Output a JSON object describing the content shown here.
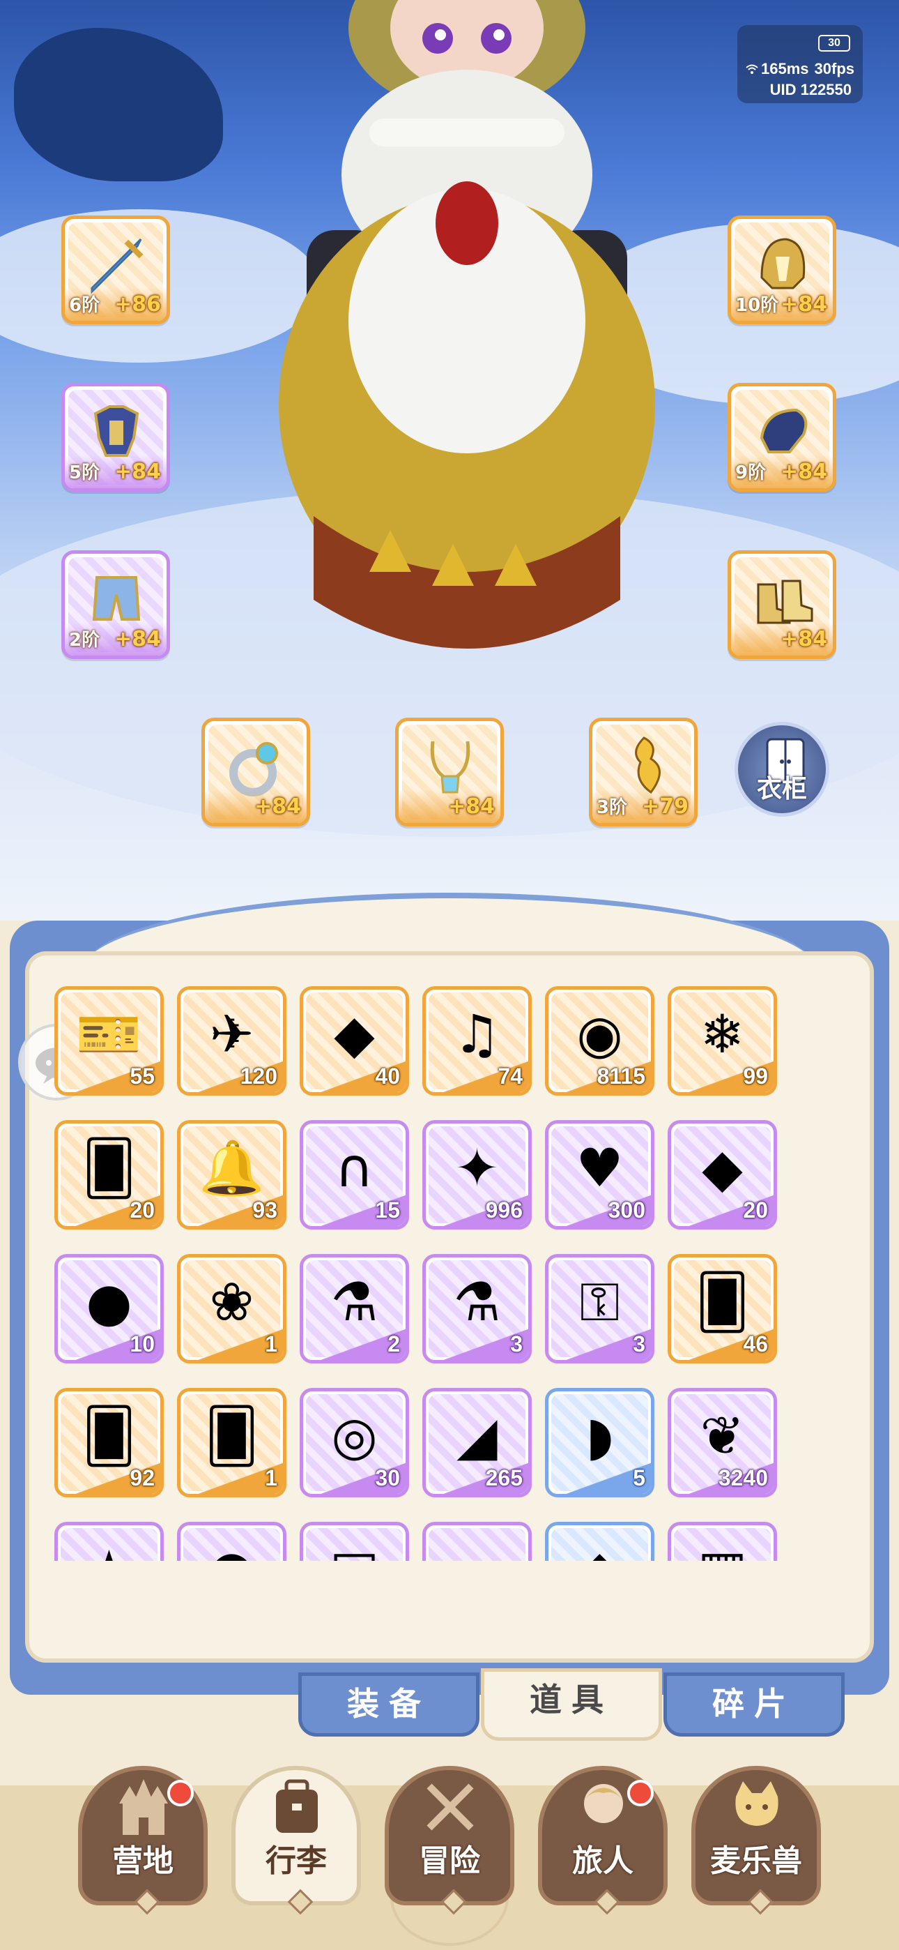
{
  "hud": {
    "battery": "30",
    "ping": "165ms",
    "fps": "30fps",
    "uid": "UID 122550"
  },
  "equipment": {
    "weapon": {
      "tier": "6阶",
      "bonus": "+86",
      "icon": "sword-icon",
      "rarity": "orange"
    },
    "helmet": {
      "tier": "10阶",
      "bonus": "+84",
      "icon": "helmet-icon",
      "rarity": "orange"
    },
    "armor": {
      "tier": "5阶",
      "bonus": "+84",
      "icon": "armor-icon",
      "rarity": "purple"
    },
    "gloves": {
      "tier": "9阶",
      "bonus": "+84",
      "icon": "gauntlet-icon",
      "rarity": "orange"
    },
    "pants": {
      "tier": "2阶",
      "bonus": "+84",
      "icon": "pants-icon",
      "rarity": "purple"
    },
    "boots": {
      "tier": "",
      "bonus": "+84",
      "icon": "boots-icon",
      "rarity": "orange"
    },
    "ring": {
      "tier": "",
      "bonus": "+84",
      "icon": "ring-icon",
      "rarity": "orange"
    },
    "necklace": {
      "tier": "",
      "bonus": "+84",
      "icon": "necklace-icon",
      "rarity": "orange"
    },
    "charm": {
      "tier": "3阶",
      "bonus": "+79",
      "icon": "feather-charm-icon",
      "rarity": "orange"
    }
  },
  "wardrobe_label": "衣柜",
  "inventory": {
    "items": [
      {
        "icon": "purple-ticket-icon",
        "glyph": "🎫",
        "count": "55",
        "rarity": "orange"
      },
      {
        "icon": "paper-plane-icon",
        "glyph": "✈",
        "count": "120",
        "rarity": "orange"
      },
      {
        "icon": "gold-gem-icon",
        "glyph": "◆",
        "count": "40",
        "rarity": "orange"
      },
      {
        "icon": "lyre-icon",
        "glyph": "♫",
        "count": "74",
        "rarity": "orange"
      },
      {
        "icon": "crystal-orb-icon",
        "glyph": "◉",
        "count": "8115",
        "rarity": "orange"
      },
      {
        "icon": "ice-crystal-icon",
        "glyph": "❄",
        "count": "99",
        "rarity": "orange"
      },
      {
        "icon": "outfit-card-icon",
        "glyph": "🂠",
        "count": "20",
        "rarity": "orange"
      },
      {
        "icon": "bell-icon",
        "glyph": "🔔",
        "count": "93",
        "rarity": "orange"
      },
      {
        "icon": "horseshoe-icon",
        "glyph": "∩",
        "count": "15",
        "rarity": "purple"
      },
      {
        "icon": "star-crystal-icon",
        "glyph": "✦",
        "count": "996",
        "rarity": "purple"
      },
      {
        "icon": "heart-icon",
        "glyph": "♥",
        "count": "300",
        "rarity": "purple"
      },
      {
        "icon": "purple-gem-icon",
        "glyph": "◆",
        "count": "20",
        "rarity": "purple"
      },
      {
        "icon": "heart-coin-icon",
        "glyph": "●",
        "count": "10",
        "rarity": "purple"
      },
      {
        "icon": "seed-pack-icon",
        "glyph": "❀",
        "count": "1",
        "rarity": "orange"
      },
      {
        "icon": "blue-potion-icon",
        "glyph": "⚗",
        "count": "2",
        "rarity": "purple"
      },
      {
        "icon": "red-potion-icon",
        "glyph": "⚗",
        "count": "3",
        "rarity": "purple"
      },
      {
        "icon": "golden-key-icon",
        "glyph": "⚿",
        "count": "3",
        "rarity": "purple"
      },
      {
        "icon": "blue-card-icon",
        "glyph": "🂠",
        "count": "46",
        "rarity": "orange"
      },
      {
        "icon": "gold-card-icon",
        "glyph": "🂠",
        "count": "92",
        "rarity": "orange"
      },
      {
        "icon": "orange-card-icon",
        "glyph": "🂠",
        "count": "1",
        "rarity": "orange"
      },
      {
        "icon": "cat-mirror-icon",
        "glyph": "◎",
        "count": "30",
        "rarity": "purple"
      },
      {
        "icon": "cheese-icon",
        "glyph": "◢",
        "count": "265",
        "rarity": "purple"
      },
      {
        "icon": "meat-icon",
        "glyph": "◗",
        "count": "5",
        "rarity": "blue"
      },
      {
        "icon": "gold-leaf-icon",
        "glyph": "❦",
        "count": "3240",
        "rarity": "purple"
      },
      {
        "icon": "partial-item-icon",
        "glyph": "★",
        "count": "",
        "rarity": "purple"
      },
      {
        "icon": "partial-item-icon",
        "glyph": "●",
        "count": "",
        "rarity": "purple"
      },
      {
        "icon": "partial-item-icon",
        "glyph": "▤",
        "count": "",
        "rarity": "purple"
      },
      {
        "icon": "partial-item-icon",
        "glyph": "▰",
        "count": "",
        "rarity": "purple"
      },
      {
        "icon": "partial-item-icon",
        "glyph": "◆",
        "count": "",
        "rarity": "blue"
      },
      {
        "icon": "partial-item-icon",
        "glyph": "▦",
        "count": "",
        "rarity": "purple"
      }
    ]
  },
  "tabs": [
    {
      "label": "装备",
      "active": false
    },
    {
      "label": "道具",
      "active": true
    },
    {
      "label": "碎片",
      "active": false
    }
  ],
  "nav": [
    {
      "label": "营地",
      "icon": "castle-icon",
      "badge": true,
      "active": false
    },
    {
      "label": "行李",
      "icon": "backpack-icon",
      "badge": false,
      "active": true
    },
    {
      "label": "冒险",
      "icon": "crossed-swords-icon",
      "badge": false,
      "active": false
    },
    {
      "label": "旅人",
      "icon": "traveler-icon",
      "badge": true,
      "active": false
    },
    {
      "label": "麦乐兽",
      "icon": "cat-pet-icon",
      "badge": false,
      "active": false
    }
  ],
  "colors": {
    "orange_rarity": "#f0a63a",
    "purple_rarity": "#c78af0",
    "blue_rarity": "#7aa7ec",
    "bonus_text": "#ffd04c",
    "badge": "#ee4b3b"
  }
}
